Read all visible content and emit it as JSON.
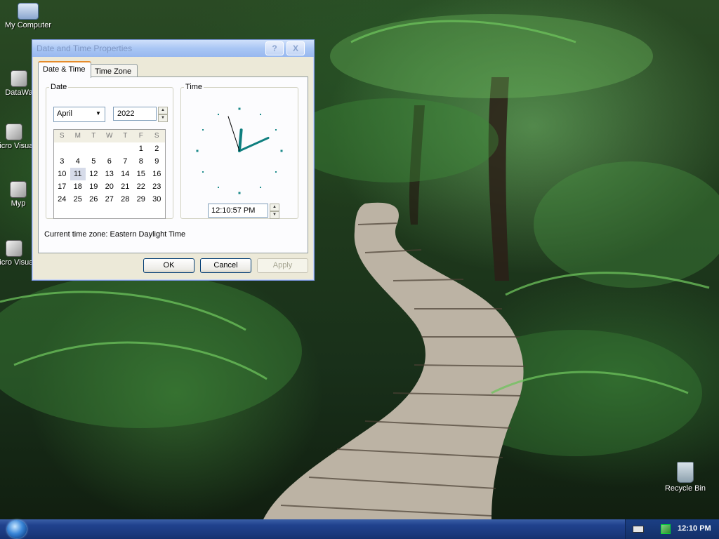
{
  "desktop": {
    "icons": [
      {
        "label": "My Computer"
      },
      {
        "label": "DataWa"
      },
      {
        "label": "Micro Visual"
      },
      {
        "label": "Myp"
      },
      {
        "label": "Micro Visual"
      },
      {
        "label": "Recycle Bin"
      }
    ]
  },
  "dialog": {
    "title": "Date and Time Properties",
    "help_glyph": "?",
    "close_glyph": "X",
    "tabs": [
      "Date & Time",
      "Time Zone"
    ],
    "date_label": "Date",
    "time_label": "Time",
    "month": "April",
    "year": "2022",
    "calendar": {
      "weekdays": [
        "S",
        "M",
        "T",
        "W",
        "T",
        "F",
        "S"
      ],
      "weeks": [
        [
          "",
          "",
          "",
          "",
          "",
          "1",
          "2"
        ],
        [
          "3",
          "4",
          "5",
          "6",
          "7",
          "8",
          "9"
        ],
        [
          "10",
          "11",
          "12",
          "13",
          "14",
          "15",
          "16"
        ],
        [
          "17",
          "18",
          "19",
          "20",
          "21",
          "22",
          "23"
        ],
        [
          "24",
          "25",
          "26",
          "27",
          "28",
          "29",
          "30"
        ]
      ],
      "selected_day": "11"
    },
    "time_value": "12:10:57 PM",
    "clock": {
      "hour": 12,
      "minute": 10,
      "second": 57
    },
    "timezone_text": "Current time zone:  Eastern Daylight Time",
    "buttons": {
      "ok": "OK",
      "cancel": "Cancel",
      "apply": "Apply"
    }
  },
  "taskbar": {
    "clock": "12:10 PM"
  },
  "colors": {
    "clock_hand": "#0f7f7f",
    "clock_tick": "#1b8a8a",
    "taskbar": "#1b3a7f"
  }
}
